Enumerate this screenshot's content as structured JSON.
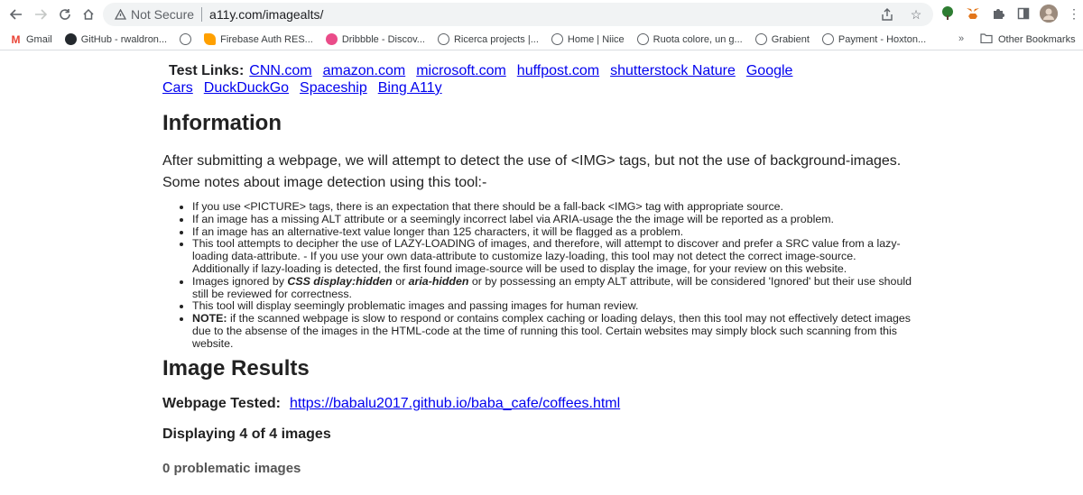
{
  "browser": {
    "security_label": "Not Secure",
    "url": "a11y.com/imagealts/"
  },
  "bookmarks": [
    {
      "label": "Gmail",
      "icon": "gmail-icon",
      "color": "#ea4335"
    },
    {
      "label": "GitHub - rwaldron...",
      "icon": "github-icon",
      "color": "#24292e"
    },
    {
      "label": "",
      "icon": "globe-icon",
      "color": "#5f6368"
    },
    {
      "label": "Firebase Auth RES...",
      "icon": "firebase-icon",
      "color": "#ffa000"
    },
    {
      "label": "Dribbble - Discov...",
      "icon": "dribbble-icon",
      "color": "#ea4c89"
    },
    {
      "label": "Ricerca projects |...",
      "icon": "globe-icon",
      "color": "#5f6368"
    },
    {
      "label": "Home | Niice",
      "icon": "globe-icon",
      "color": "#5f6368"
    },
    {
      "label": "Ruota colore, un g...",
      "icon": "globe-icon",
      "color": "#5f6368"
    },
    {
      "label": "Grabient",
      "icon": "globe-icon",
      "color": "#5f6368"
    },
    {
      "label": "Payment - Hoxton...",
      "icon": "globe-icon",
      "color": "#5f6368"
    }
  ],
  "bookmarks_more": "»",
  "other_bookmarks": "Other Bookmarks",
  "page": {
    "test_links_label": "Test Links:",
    "test_links": [
      "CNN.com",
      "amazon.com",
      "microsoft.com",
      "huffpost.com",
      "shutterstock Nature",
      "Google Cars",
      "DuckDuckGo",
      "Spaceship",
      "Bing A11y"
    ],
    "info_heading": "Information",
    "intro1": "After submitting a webpage, we will attempt to detect the use of <IMG> tags, but not the use of background-images.",
    "intro2": "Some notes about image detection using this tool:-",
    "notes": {
      "n1": "If you use <PICTURE> tags, there is an expectation that there should be a fall-back <IMG> tag with appropriate source.",
      "n2": "If an image has a missing ALT attribute or a seemingly incorrect label via ARIA-usage the the image will be reported as a problem.",
      "n3": "If an image has an alternative-text value longer than 125 characters, it will be flagged as a problem.",
      "n4": "This tool attempts to decipher the use of LAZY-LOADING of images, and therefore, will attempt to discover and prefer a SRC value from a lazy-loading data-attribute. - If you use your own data-attribute to customize lazy-loading, this tool may not detect the correct image-source. Additionally if lazy-loading is detected, the first found image-source will be used to display the image, for your review on this website.",
      "n5_a": "Images ignored by ",
      "n5_b": "CSS display:hidden",
      "n5_c": " or ",
      "n5_d": "aria-hidden",
      "n5_e": " or by possessing an empty ALT attribute, will be considered 'Ignored' but their use should still be reviewed for correctness.",
      "n6": "This tool will display seemingly problematic images and passing images for human review.",
      "n7_label": "NOTE:",
      "n7_text": " if the scanned webpage is slow to respond or contains complex caching or loading delays, then this tool may not effectively detect images due to the absense of the images in the HTML-code at the time of running this tool. Certain websites may simply block such scanning from this website."
    },
    "results_heading": "Image Results",
    "tested_label": "Webpage Tested:",
    "tested_url": "https://babalu2017.github.io/baba_cafe/coffees.html",
    "displaying": "Displaying 4 of 4 images",
    "problematic": "0 problematic images"
  }
}
